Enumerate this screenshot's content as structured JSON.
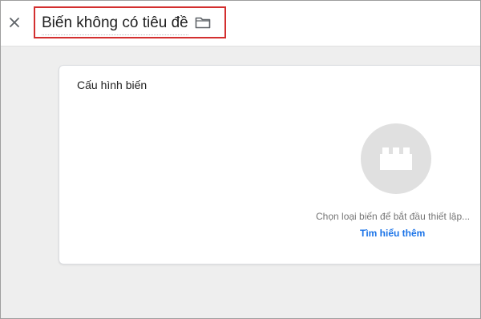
{
  "header": {
    "title": "Biến không có tiêu đề",
    "close_icon": "close-icon",
    "folder_icon": "folder-icon",
    "highlight_color": "#d32f2f"
  },
  "card": {
    "title": "Cấu hình biến",
    "placeholder_icon": "building-block-icon",
    "hint": "Chọn loại biến để bắt đầu thiết lập...",
    "learn_more": "Tìm hiểu thêm",
    "link_color": "#1a73e8"
  }
}
